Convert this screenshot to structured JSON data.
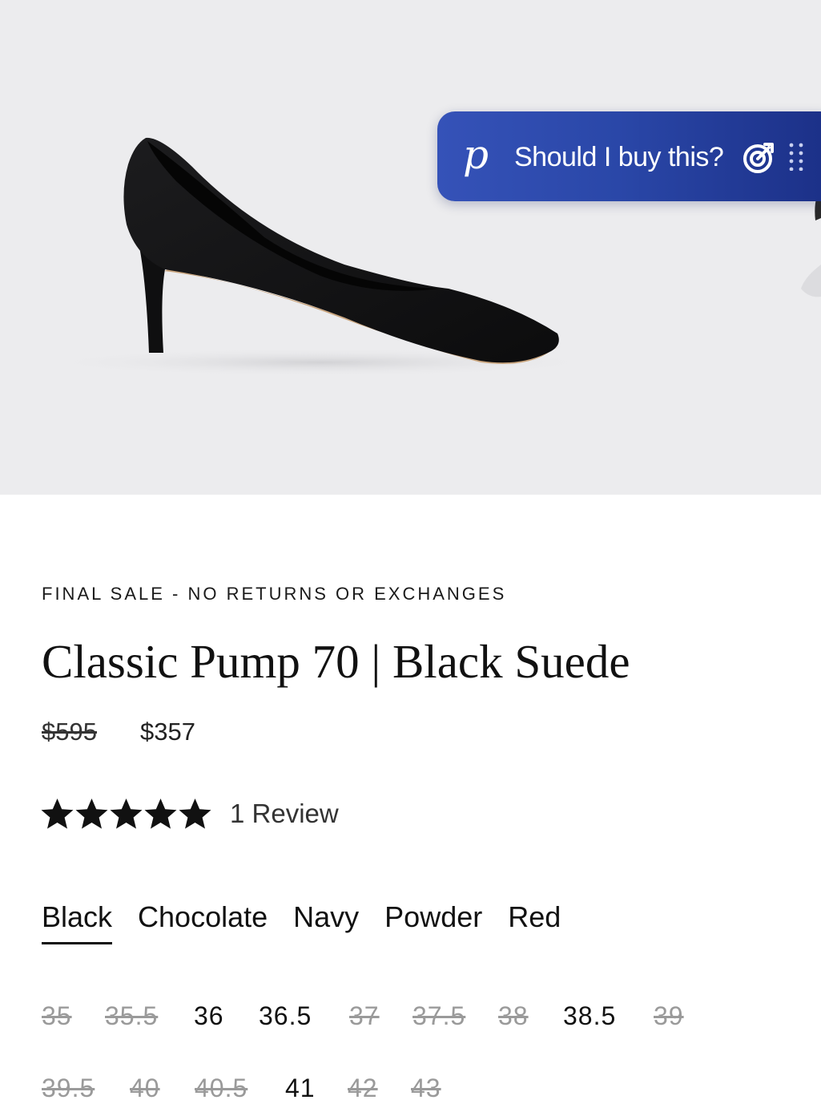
{
  "assistant": {
    "logo": "p",
    "prompt": "Should I buy this?"
  },
  "product": {
    "notice": "FINAL SALE - NO RETURNS OR EXCHANGES",
    "title": "Classic Pump 70 | Black Suede",
    "price_original": "$595",
    "price_sale": "$357",
    "rating": 5,
    "rating_max": 5,
    "review_text": "1 Review"
  },
  "colors": [
    {
      "label": "Black",
      "selected": true
    },
    {
      "label": "Chocolate",
      "selected": false
    },
    {
      "label": "Navy",
      "selected": false
    },
    {
      "label": "Powder",
      "selected": false
    },
    {
      "label": "Red",
      "selected": false
    }
  ],
  "sizes": [
    {
      "label": "35",
      "available": false
    },
    {
      "label": "35.5",
      "available": false
    },
    {
      "label": "36",
      "available": true
    },
    {
      "label": "36.5",
      "available": true
    },
    {
      "label": "37",
      "available": false
    },
    {
      "label": "37.5",
      "available": false
    },
    {
      "label": "38",
      "available": false
    },
    {
      "label": "38.5",
      "available": true
    },
    {
      "label": "39",
      "available": false
    },
    {
      "label": "39.5",
      "available": false
    },
    {
      "label": "40",
      "available": false
    },
    {
      "label": "40.5",
      "available": false
    },
    {
      "label": "41",
      "available": true
    },
    {
      "label": "42",
      "available": false
    },
    {
      "label": "43",
      "available": false
    }
  ],
  "colors_theme": {
    "accent_gradient_start": "#3552b8",
    "accent_gradient_end": "#1b2f86",
    "unavailable_text": "#9a9a9a",
    "hero_background": "#ececee"
  },
  "icons": {
    "assistant_logo": "p-logo-icon",
    "target": "target-check-icon",
    "drag": "drag-handle-icon",
    "star": "star-icon"
  }
}
